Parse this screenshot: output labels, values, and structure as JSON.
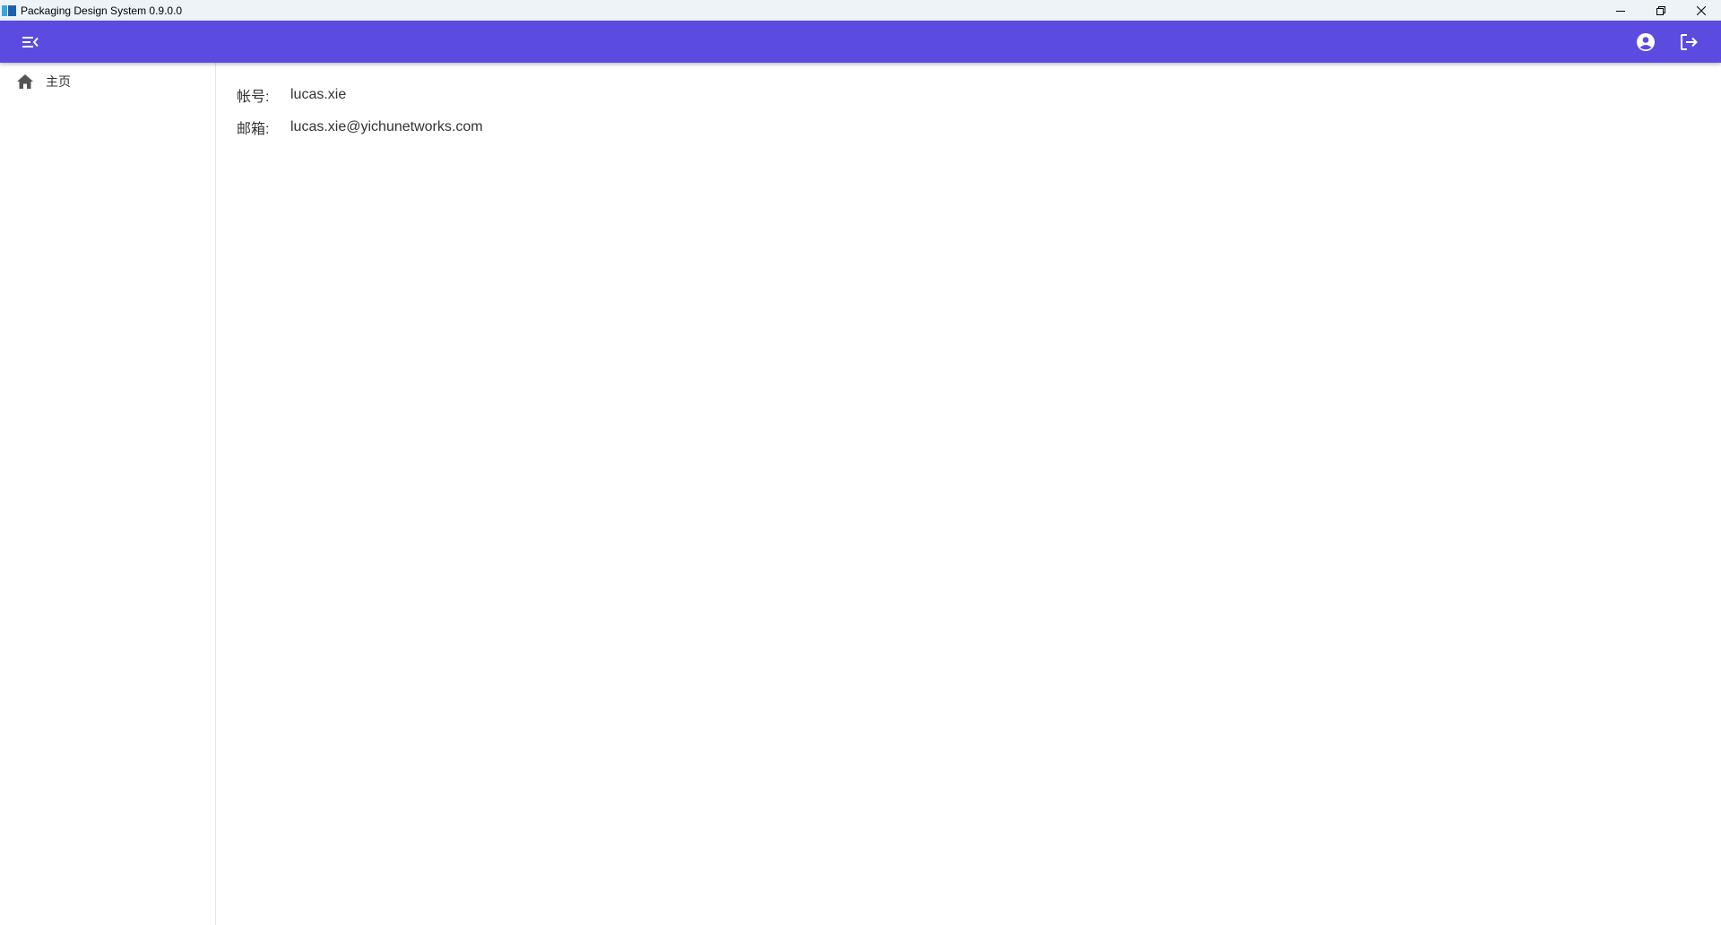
{
  "window": {
    "title": "Packaging Design System 0.9.0.0",
    "app_icon": "app-logo-icon",
    "controls": [
      "minimize-icon",
      "restore-icon",
      "close-icon"
    ]
  },
  "appbar": {
    "color": "#5b4be0",
    "menu_icon": "menu-collapse-icon",
    "account_icon": "account-circle-icon",
    "logout_icon": "logout-icon"
  },
  "sidebar": {
    "items": [
      {
        "label": "主页",
        "icon": "home-icon"
      }
    ]
  },
  "profile": {
    "account_label": "帐号:",
    "account_value": "lucas.xie",
    "email_label": "邮箱:",
    "email_value": "lucas.xie@yichunetworks.com"
  }
}
